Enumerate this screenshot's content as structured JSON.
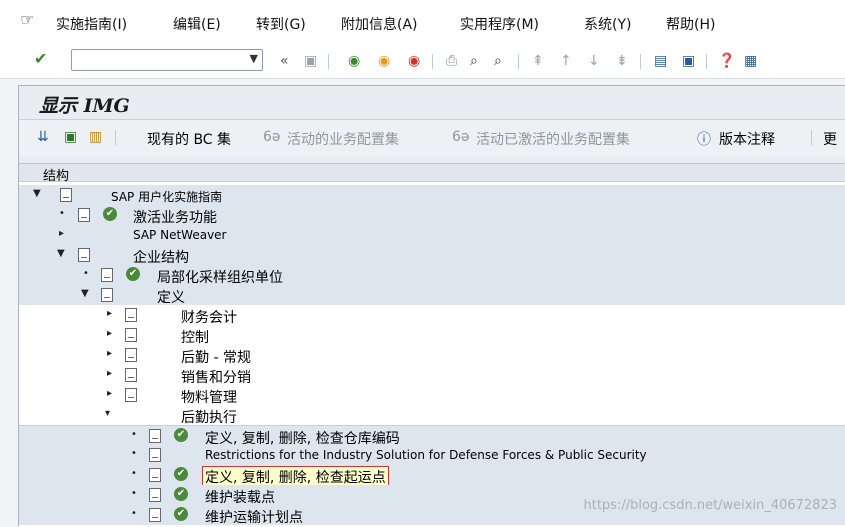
{
  "menubar": {
    "items": [
      "实施指南(I)",
      "编辑(E)",
      "转到(G)",
      "附加信息(A)",
      "实用程序(M)",
      "系统(Y)",
      "帮助(H)"
    ]
  },
  "toolbar": {
    "command_value": ""
  },
  "screen": {
    "title": "显示 IMG"
  },
  "appbar": {
    "existing_bc_sets": "现有的 BC 集",
    "active_business_config_sets": "活动的业务配置集",
    "active_activated_business_config_sets": "活动已激活的业务配置集",
    "release_notes": "版本注释",
    "more": "更"
  },
  "tree": {
    "header": "结构",
    "nodes": [
      {
        "label": "SAP 用户化实施指南"
      },
      {
        "label": "激活业务功能"
      },
      {
        "label": "SAP NetWeaver"
      },
      {
        "label": "企业结构"
      },
      {
        "label": "局部化采样组织单位"
      },
      {
        "label": "定义"
      },
      {
        "label": "财务会计"
      },
      {
        "label": "控制"
      },
      {
        "label": "后勤 - 常规"
      },
      {
        "label": "销售和分销"
      },
      {
        "label": "物料管理"
      },
      {
        "label": "后勤执行"
      },
      {
        "label": "定义, 复制, 删除, 检查仓库编码"
      },
      {
        "label": "Restrictions for the Industry Solution for Defense Forces & Public Security"
      },
      {
        "label": "定义, 复制, 删除, 检查起运点"
      },
      {
        "label": "维护装载点"
      },
      {
        "label": "维护运输计划点"
      }
    ]
  },
  "watermark": "https://blog.csdn.net/weixin_40672823"
}
